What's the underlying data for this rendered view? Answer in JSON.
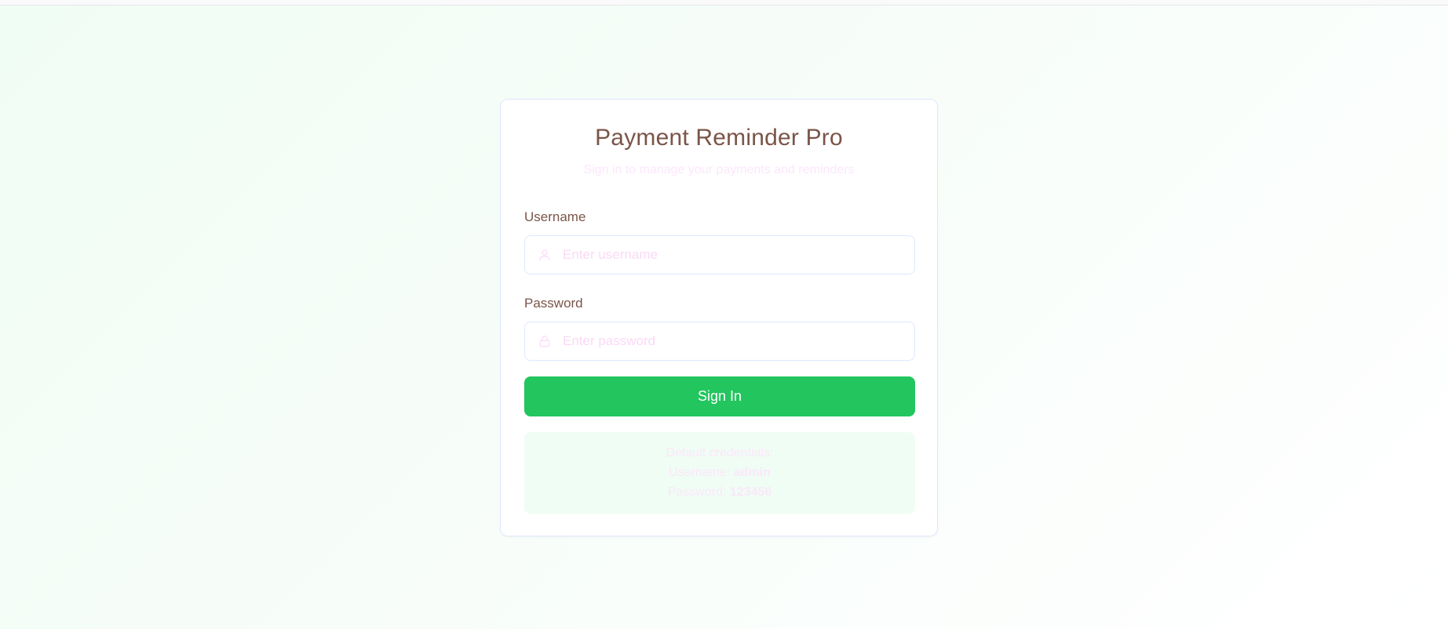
{
  "app": {
    "title": "Payment Reminder Pro",
    "subtitle": "Sign in to manage your payments and reminders"
  },
  "form": {
    "username_label": "Username",
    "username_placeholder": "Enter username",
    "username_value": "",
    "username_icon": "user-icon",
    "password_label": "Password",
    "password_placeholder": "Enter password",
    "password_value": "",
    "password_icon": "lock-icon",
    "submit_label": "Sign In"
  },
  "demo": {
    "heading": "Default credentials:",
    "username_label": "Username:",
    "username_value": "admin",
    "password_label": "Password:",
    "password_value": "123456"
  },
  "colors": {
    "accent": "#22c55e",
    "heading_text": "#7a5548",
    "faint_text": "#fbe7fb",
    "card_border": "#e0e7ff",
    "info_background": "#f0fdf4"
  }
}
